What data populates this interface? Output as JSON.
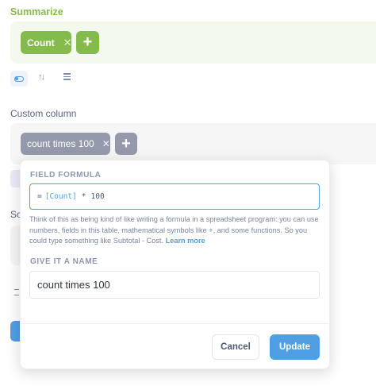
{
  "summarize": {
    "heading": "Summarize",
    "metric_pill": "Count",
    "remove_glyph": "✕",
    "add_glyph": "+"
  },
  "custom_column": {
    "heading": "Custom column",
    "column_pill": "count times 100",
    "remove_glyph": "✕",
    "add_glyph": "+"
  },
  "background": {
    "sort_heading_fragment": "So"
  },
  "popover": {
    "formula_label": "FIELD FORMULA",
    "formula": {
      "equals": "=",
      "field": "[Count]",
      "operator": "*",
      "number": "100"
    },
    "help_text": "Think of this as being kind of like writing a formula in a spreadsheet program: you can use numbers, fields in this table, mathematical symbols like +, and some functions. So you could type something like Subtotal - Cost.",
    "learn_more": "Learn more",
    "name_label": "GIVE IT A NAME",
    "name_value": "count times 100",
    "cancel_label": "Cancel",
    "update_label": "Update"
  },
  "colors": {
    "summarize_green": "#84bb4c",
    "brand_blue": "#509ee3",
    "pill_gray": "#949aab"
  },
  "icons": {
    "display_toggle": "toggle-icon",
    "sort": "sort-icon",
    "list": "list-icon"
  }
}
